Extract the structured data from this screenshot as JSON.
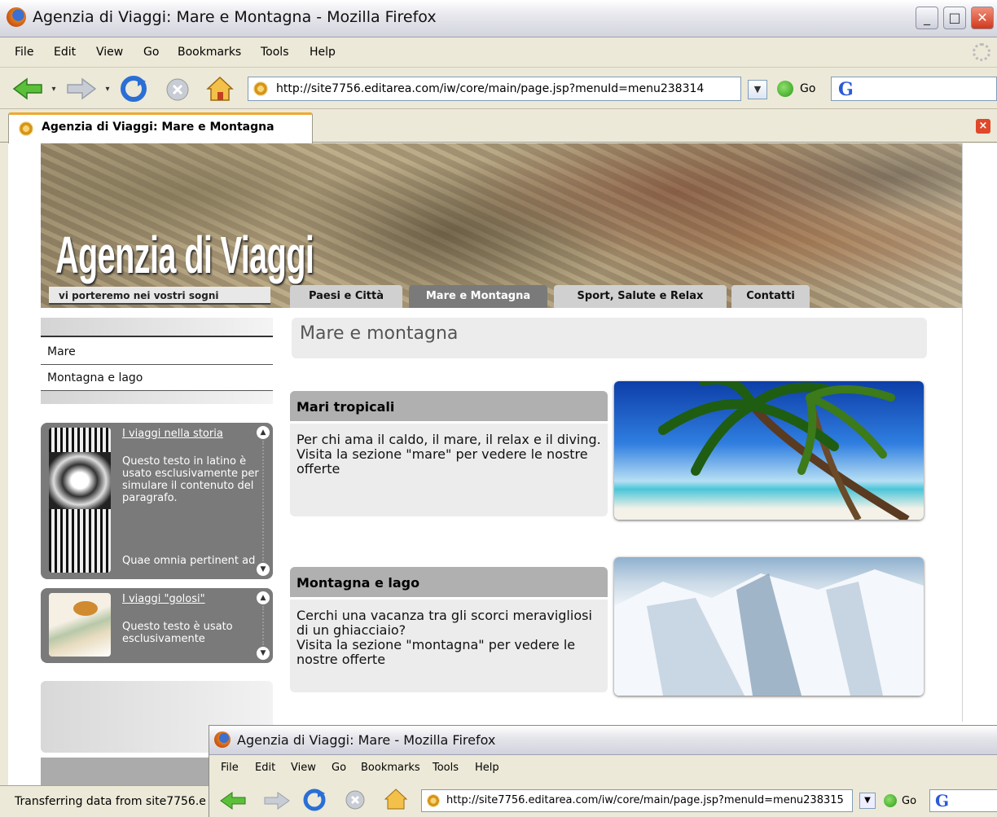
{
  "window": {
    "title": "Agenzia di Viaggi: Mare e Montagna - Mozilla Firefox",
    "buttons": {
      "minimize": "_",
      "maximize": "□",
      "close": "✕"
    }
  },
  "menu": [
    "File",
    "Edit",
    "View",
    "Go",
    "Bookmarks",
    "Tools",
    "Help"
  ],
  "navigation": {
    "url": "http://site7756.editarea.com/iw/core/main/page.jsp?menuId=menu238314",
    "go_label": "Go",
    "search_logo": "G"
  },
  "tab": {
    "label": "Agenzia di Viaggi: Mare e Montagna"
  },
  "site": {
    "logo": "Agenzia di Viaggi",
    "slogan": "vi porteremo nei vostri sogni",
    "main_tabs": [
      "Paesi e Città",
      "Mare e Montagna",
      "Sport, Salute e Relax",
      "Contatti"
    ],
    "active_tab": "Mare e Montagna",
    "side_menu": [
      "Mare",
      "Montagna e lago"
    ],
    "news": [
      {
        "title": "I viaggi nella storia",
        "text": "Questo testo in latino è usato esclusivamente per simulare il contenuto del paragrafo.",
        "text2": "Quae omnia pertinent ad"
      },
      {
        "title": "I viaggi \"golosi\"",
        "text": "Questo testo è usato esclusivamente"
      }
    ],
    "page_title": "Mare e montagna",
    "cards": [
      {
        "title": "Mari tropicali",
        "body": "Per chi ama il caldo, il mare, il relax e il diving.\nVisita la sezione \"mare\" per vedere le nostre offerte"
      },
      {
        "title": "Montagna e lago",
        "body": "Cerchi una vacanza tra gli scorci meravigliosi di un ghiacciaio?\nVisita la sezione \"montagna\" per vedere le nostre offerte"
      }
    ]
  },
  "status_bar": "Transferring data from site7756.e",
  "second_window": {
    "title": "Agenzia di Viaggi: Mare - Mozilla Firefox",
    "menu": [
      "File",
      "Edit",
      "View",
      "Go",
      "Bookmarks",
      "Tools",
      "Help"
    ],
    "url": "http://site7756.editarea.com/iw/core/main/page.jsp?menuId=menu238315",
    "go_label": "Go",
    "search_logo": "G"
  }
}
